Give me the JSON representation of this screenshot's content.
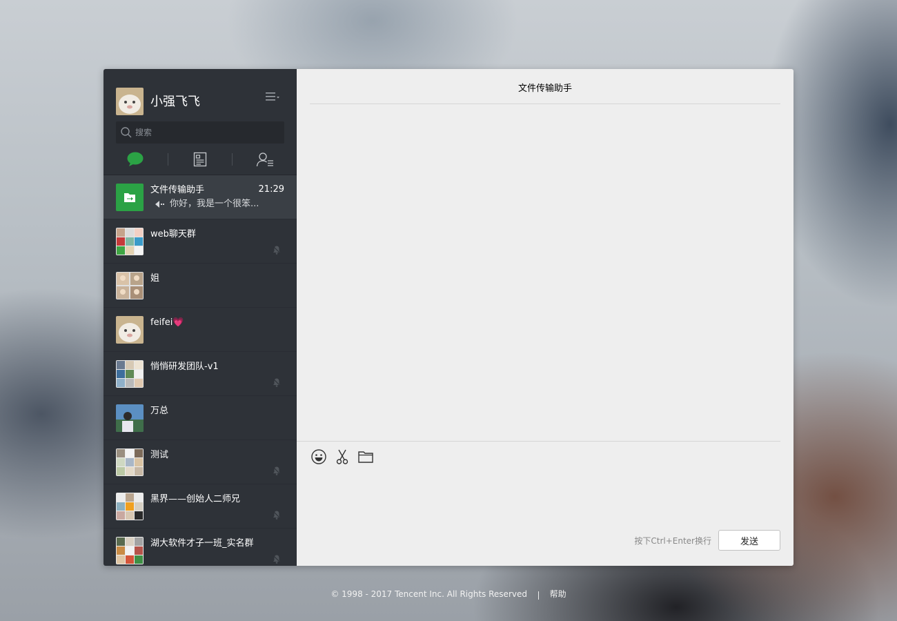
{
  "user": {
    "name": "小强飞飞"
  },
  "search": {
    "placeholder": "搜索"
  },
  "chat": {
    "title": "文件传输助手"
  },
  "conversations": [
    {
      "name": "文件传输助手",
      "time": "21:29",
      "preview": "你好，我是一个很笨..."
    },
    {
      "name": "web聊天群"
    },
    {
      "name": "姐"
    },
    {
      "name": "feifei💗"
    },
    {
      "name": "悄悄研发团队-v1"
    },
    {
      "name": "万总"
    },
    {
      "name": "测试"
    },
    {
      "name": "黑界——创始人二师兄"
    },
    {
      "name": "湖大软件才子一班_实名群"
    }
  ],
  "composer": {
    "hint": "按下Ctrl+Enter换行",
    "send_label": "发送"
  },
  "footer": {
    "copyright": "© 1998 - 2017 Tencent Inc. All Rights Reserved",
    "help": "帮助"
  },
  "colors": {
    "accent": "#2ba245",
    "sidebar_bg": "#2e3238",
    "active_bg": "#3a3f45",
    "main_bg": "#eeeeee"
  }
}
